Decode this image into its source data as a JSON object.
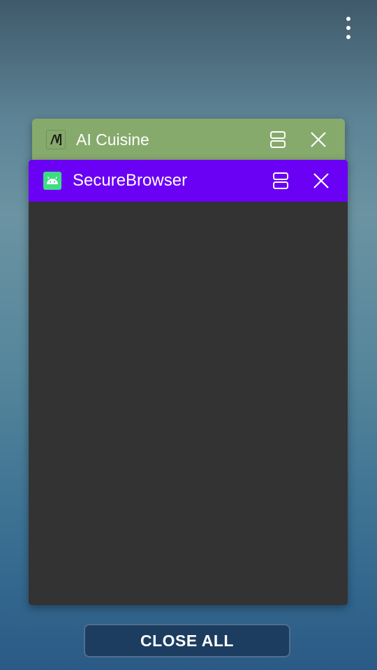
{
  "screen": {
    "type": "recent-apps-overview",
    "overflow_menu_icon": "vertical-dots-icon"
  },
  "tasks": [
    {
      "title": "AI Cuisine",
      "icon": "ai-cuisine-app-icon",
      "header_color": "#86aa6c",
      "actions": [
        "split-screen-icon",
        "close-icon"
      ]
    },
    {
      "title": "SecureBrowser",
      "icon": "android-app-icon",
      "header_color": "#6a00f4",
      "actions": [
        "split-screen-icon",
        "close-icon"
      ]
    }
  ],
  "footer": {
    "close_all_label": "CLOSE ALL"
  },
  "colors": {
    "front_card_body": "#333333",
    "close_all_bg": "#1c3d60"
  }
}
